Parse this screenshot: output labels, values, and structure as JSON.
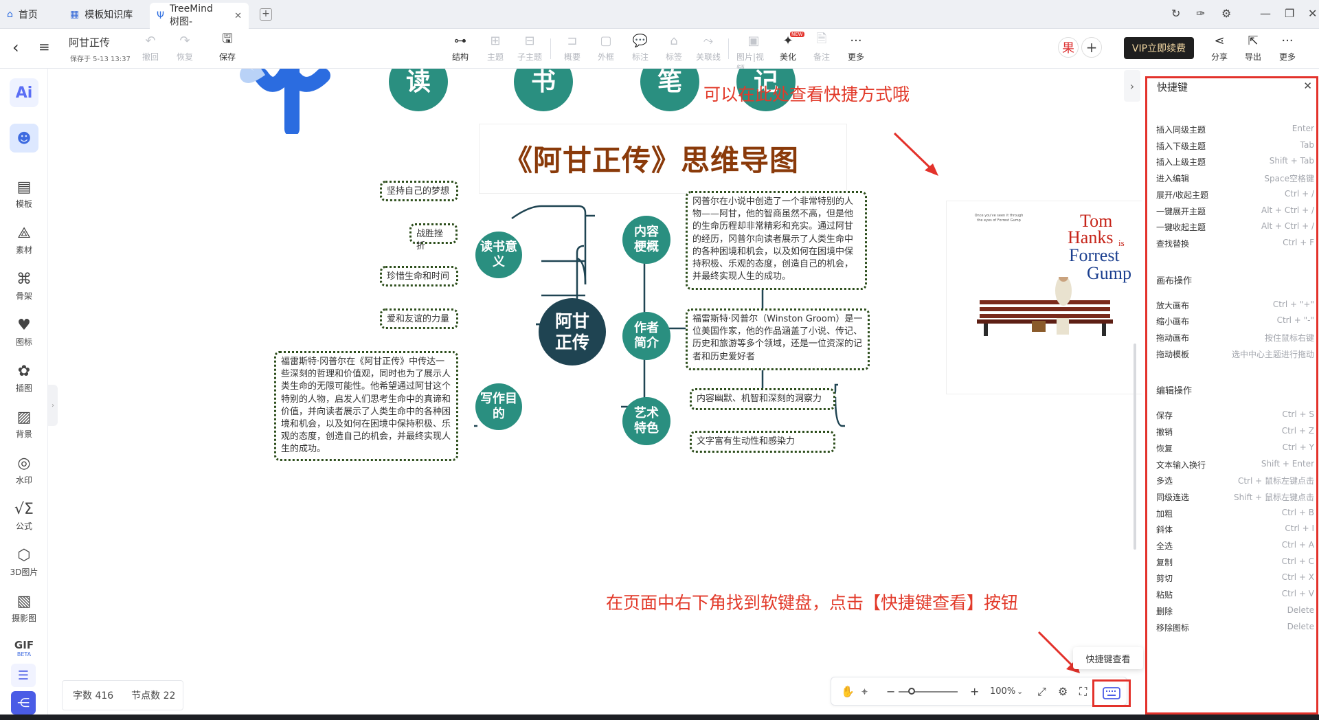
{
  "tabs": [
    {
      "label": "首页",
      "icon": "home-icon"
    },
    {
      "label": "模板知识库",
      "icon": "book-icon"
    },
    {
      "label": "TreeMind树图-",
      "icon": "treemind-logo-icon"
    }
  ],
  "header": {
    "doc_title": "阿甘正传",
    "save_status": "保存于 5-13 13:37",
    "undo": "撤回",
    "redo": "恢复",
    "save": "保存"
  },
  "toolbar": [
    {
      "label": "结构",
      "icon": "structure-icon",
      "enabled": true
    },
    {
      "label": "主题",
      "icon": "topic-icon",
      "enabled": false
    },
    {
      "label": "子主题",
      "icon": "subtopic-icon",
      "enabled": false
    },
    {
      "label": "概要",
      "icon": "summary-icon",
      "enabled": false
    },
    {
      "label": "外框",
      "icon": "frame-icon",
      "enabled": false
    },
    {
      "label": "标注",
      "icon": "callout-icon",
      "enabled": false
    },
    {
      "label": "标签",
      "icon": "tag-icon",
      "enabled": false
    },
    {
      "label": "关联线",
      "icon": "relation-line-icon",
      "enabled": false
    },
    {
      "label": "图片|视频",
      "icon": "image-video-icon",
      "enabled": false
    },
    {
      "label": "美化",
      "icon": "beautify-icon",
      "enabled": true,
      "badge": "NEW"
    },
    {
      "label": "备注",
      "icon": "note-icon",
      "enabled": false
    },
    {
      "label": "更多",
      "icon": "more-icon",
      "enabled": true
    }
  ],
  "right_toolbar": {
    "vip": "VIP立即续费",
    "share": "分享",
    "export": "导出",
    "more": "更多"
  },
  "sidebar": [
    {
      "label": "模板",
      "icon": "template-icon"
    },
    {
      "label": "素材",
      "icon": "material-icon"
    },
    {
      "label": "骨架",
      "icon": "skeleton-icon"
    },
    {
      "label": "图标",
      "icon": "icon-library-icon"
    },
    {
      "label": "插图",
      "icon": "illustration-icon"
    },
    {
      "label": "背景",
      "icon": "background-icon"
    },
    {
      "label": "水印",
      "icon": "watermark-icon"
    },
    {
      "label": "公式",
      "icon": "formula-icon"
    },
    {
      "label": "3D图片",
      "icon": "3d-image-icon"
    },
    {
      "label": "摄影图",
      "icon": "photo-icon"
    }
  ],
  "gif": {
    "label": "GIF",
    "badge": "BETA"
  },
  "mindmap": {
    "header_chars": [
      "读",
      "书",
      "笔",
      "记"
    ],
    "title": "《阿甘正传》思维导图",
    "center": "阿甘正传",
    "branches": {
      "reading_meaning": "读书意义",
      "writing_purpose": "写作目的",
      "content_overview": "内容梗概",
      "author_intro": "作者简介",
      "art_features": "艺术特色"
    },
    "leaves": {
      "dream": "坚持自己的梦想",
      "overcome": "战胜挫折",
      "cherish": "珍惜生命和时间",
      "love": "爱和友谊的力量",
      "purpose_text": "福雷斯特·冈普尔在《阿甘正传》中传达一些深刻的哲理和价值观，同时也为了展示人类生命的无限可能性。他希望通过阿甘这个特别的人物，启发人们思考生命中的真谛和价值，并向读者展示了人类生命中的各种困境和机会，以及如何在困境中保持积极、乐观的态度，创造自己的机会，并最终实现人生的成功。",
      "overview_text": "冈普尔在小说中创造了一个非常特别的人物——阿甘，他的智商虽然不高，但是他的生命历程却非常精彩和充实。通过阿甘的经历，冈普尔向读者展示了人类生命中的各种困境和机会，以及如何在困境中保持积极、乐观的态度，创造自己的机会，并最终实现人生的成功。",
      "author_text": "福雷斯特·冈普尔（Winston Groom）是一位美国作家，他的作品涵盖了小说、传记、历史和旅游等多个领域，还是一位资深的记者和历史爱好者",
      "art1": "内容幽默、机智和深刻的洞察力",
      "art2": "文字富有生动性和感染力"
    },
    "poster": {
      "tagline": "Once you've seen it through the eyes of Forrest Gump",
      "line1": "Tom",
      "line2": "Hanks",
      "line3": "is",
      "line4": "Forrest",
      "line5": "Gump"
    }
  },
  "annotations": {
    "top": "可以在此处查看快捷方式哦",
    "bottom": "在页面中右下角找到软键盘，点击【快捷键查看】按钮"
  },
  "stats": {
    "words": "字数 416",
    "nodes": "节点数 22"
  },
  "zoom": "100%",
  "tooltip": "快捷键查看",
  "shortcuts_panel": {
    "title": "快捷键",
    "groups": [
      {
        "name": "",
        "items": [
          {
            "k": "插入同级主题",
            "v": "Enter"
          },
          {
            "k": "插入下级主题",
            "v": "Tab"
          },
          {
            "k": "插入上级主题",
            "v": "Shift + Tab"
          },
          {
            "k": "进入编辑",
            "v": "Space空格键"
          },
          {
            "k": "展开/收起主题",
            "v": "Ctrl + /"
          },
          {
            "k": "一键展开主题",
            "v": "Alt + Ctrl + /"
          },
          {
            "k": "一键收起主题",
            "v": "Alt + Ctrl + /"
          },
          {
            "k": "查找替换",
            "v": "Ctrl + F"
          }
        ]
      },
      {
        "name": "画布操作",
        "items": [
          {
            "k": "放大画布",
            "v": "Ctrl + \"+\""
          },
          {
            "k": "缩小画布",
            "v": "Ctrl + \"-\""
          },
          {
            "k": "拖动画布",
            "v": "按住鼠标右键"
          },
          {
            "k": "拖动模板",
            "v": "选中中心主题进行拖动"
          }
        ]
      },
      {
        "name": "编辑操作",
        "items": [
          {
            "k": "保存",
            "v": "Ctrl + S"
          },
          {
            "k": "撤销",
            "v": "Ctrl + Z"
          },
          {
            "k": "恢复",
            "v": "Ctrl + Y"
          },
          {
            "k": "文本输入换行",
            "v": "Shift + Enter"
          },
          {
            "k": "多选",
            "v": "Ctrl + 鼠标左键点击"
          },
          {
            "k": "同级连选",
            "v": "Shift + 鼠标左键点击"
          },
          {
            "k": "加粗",
            "v": "Ctrl + B"
          },
          {
            "k": "斜体",
            "v": "Ctrl + I"
          },
          {
            "k": "全选",
            "v": "Ctrl + A"
          },
          {
            "k": "复制",
            "v": "Ctrl + C"
          },
          {
            "k": "剪切",
            "v": "Ctrl + X"
          },
          {
            "k": "粘贴",
            "v": "Ctrl + V"
          },
          {
            "k": "删除",
            "v": "Delete"
          },
          {
            "k": "移除图标",
            "v": "Delete"
          }
        ]
      }
    ]
  },
  "colors": {
    "node_teal": "#2a8f80",
    "center_dark": "#1f4452",
    "title_brown": "#8a3a0a",
    "annotation_red": "#e23a2a",
    "dotted_border": "#2d4e1c"
  }
}
